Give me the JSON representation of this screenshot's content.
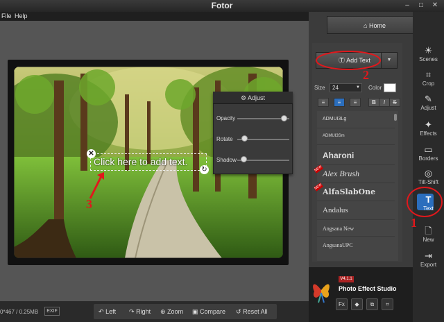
{
  "window": {
    "title": "Fotor",
    "controls": [
      "–",
      "□",
      "✕"
    ]
  },
  "menu": [
    "File",
    "Help"
  ],
  "canvas": {
    "text_placeholder": "Click here to add text.",
    "adjust_panel": {
      "title": "Adjust",
      "sliders": [
        {
          "label": "Opacity",
          "value": 1.0
        },
        {
          "label": "Rotate",
          "value": 0.0
        },
        {
          "label": "Shadow",
          "value": 0.0
        }
      ]
    },
    "annotations": [
      "1",
      "2",
      "3"
    ]
  },
  "bottom": {
    "info": "0*467 / 0.25MB",
    "exif": "EXIF",
    "buttons": [
      {
        "label": "Left",
        "icon": "rotate-left-icon"
      },
      {
        "label": "Right",
        "icon": "rotate-right-icon"
      },
      {
        "label": "Zoom",
        "icon": "zoom-icon"
      },
      {
        "label": "Compare",
        "icon": "compare-icon"
      },
      {
        "label": "Reset All",
        "icon": "reset-icon"
      }
    ]
  },
  "panel": {
    "home_label": "Home",
    "add_text_label": "Add Text",
    "size_label": "Size",
    "size_value": "24",
    "color_label": "Color",
    "color_value": "#ffffff",
    "format_buttons": [
      "≡",
      "≡",
      "≡",
      "B",
      "I",
      "S"
    ],
    "fonts": [
      {
        "name": "ADMUI3Lg",
        "new": false
      },
      {
        "name": "ADMUI3Sm",
        "new": false
      },
      {
        "name": "Aharoni",
        "new": false
      },
      {
        "name": "Alex Brush",
        "new": true
      },
      {
        "name": "AlfaSlabOne",
        "new": true
      },
      {
        "name": "Andalus",
        "new": false
      },
      {
        "name": "Angsana New",
        "new": false
      },
      {
        "name": "AngsanaUPC",
        "new": false
      }
    ],
    "new_tag": "NEW"
  },
  "promo": {
    "version": "V4.1.1",
    "title": "Photo Effect Studio",
    "icons": [
      "Fx",
      "◆",
      "⧉",
      "⌗"
    ]
  },
  "tools": [
    {
      "label": "Scenes",
      "icon": "☀"
    },
    {
      "label": "Crop",
      "icon": "⌗"
    },
    {
      "label": "Adjust",
      "icon": "✎"
    },
    {
      "label": "Effects",
      "icon": "✦"
    },
    {
      "label": "Borders",
      "icon": "▭"
    },
    {
      "label": "Tilt-Shift",
      "icon": "◎"
    },
    {
      "label": "Text",
      "icon": "T"
    },
    {
      "label": "New",
      "icon": "🗋"
    },
    {
      "label": "Export",
      "icon": "⇥"
    }
  ],
  "colors": {
    "accent": "#2b6ebd",
    "annotation": "#e0181c"
  }
}
